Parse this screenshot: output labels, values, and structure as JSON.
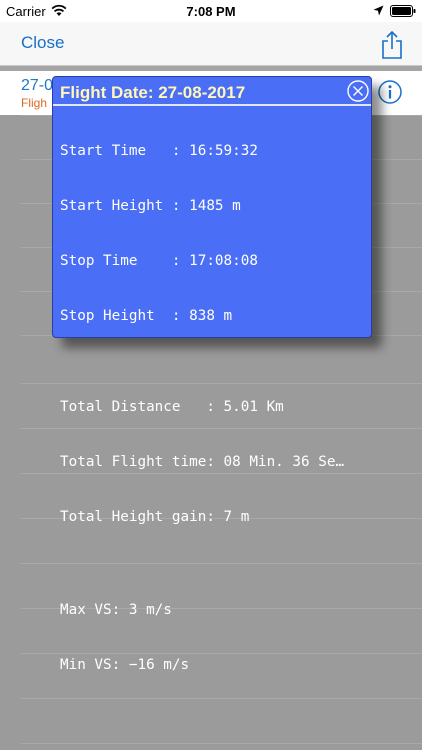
{
  "status_bar": {
    "carrier": "Carrier",
    "time": "7:08 PM"
  },
  "nav": {
    "close_label": "Close"
  },
  "list_row": {
    "date": "27-0",
    "subtitle": "Fligh"
  },
  "popup": {
    "title": "Flight Date: 27-08-2017",
    "start_time": "Start Time   : 16:59:32",
    "start_height": "Start Height : 1485 m",
    "stop_time": "Stop Time    : 17:08:08",
    "stop_height": "Stop Height  : 838 m",
    "total_distance": "Total Distance   : 5.01 Km",
    "total_flight_time": "Total Flight time: 08 Min. 36 Se…",
    "total_height_gain": "Total Height gain: 7 m",
    "max_vs": "Max VS: 3 m/s",
    "min_vs": "Min VS: −16 m/s"
  },
  "colors": {
    "popup_bg": "#4a6ef5",
    "popup_title": "#fff7b8",
    "link_blue": "#1670c9",
    "subtitle_orange": "#e06722",
    "backdrop_gray": "#9b9b9b"
  },
  "icons": {
    "wifi": "wifi-icon",
    "location": "location-arrow-icon",
    "battery": "battery-icon",
    "share": "share-icon",
    "info": "info-icon",
    "popup_close": "close-circle-icon"
  }
}
